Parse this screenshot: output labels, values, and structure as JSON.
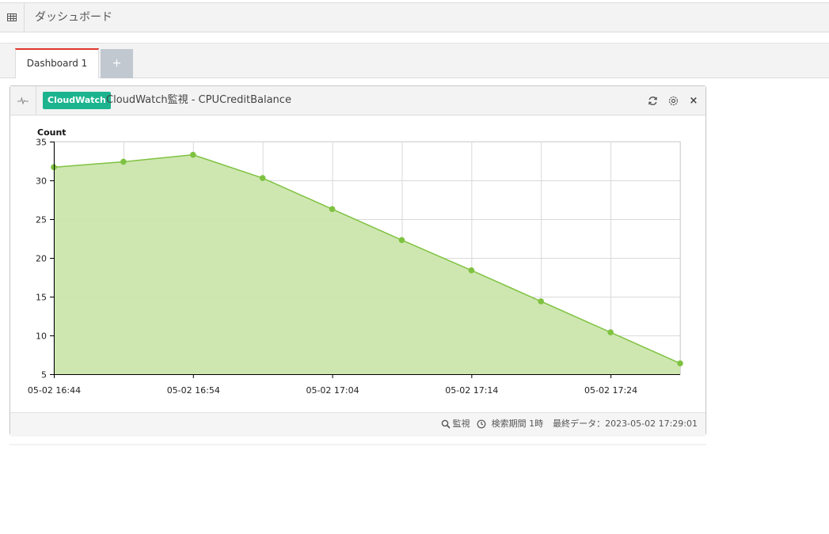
{
  "topbar": {
    "title": "ダッシュボード",
    "menu_icon": "table-grid-icon"
  },
  "tabs": [
    {
      "label": "Dashboard 1",
      "active": true
    },
    {
      "label": "+",
      "active": false
    }
  ],
  "widget": {
    "badge": "CloudWatch",
    "title": "CloudWatch監視 - CPUCreditBalance",
    "icons": [
      "pulse-icon",
      "refresh-icon",
      "settings-icon",
      "close-icon"
    ],
    "close_label": "×",
    "footer": {
      "monitor_label": "監視",
      "period_label": "検索期間 1時",
      "last_data_label": "最終データ：2023-05-02 17:29:01"
    }
  },
  "colors": {
    "accent_tab": "#e0362b",
    "badge": "#1cb48f",
    "series_line": "#7fc241",
    "series_fill": "#cbe6ac"
  },
  "chart_data": {
    "type": "area",
    "ylabel": "Count",
    "ylim": [
      5,
      35
    ],
    "yticks": [
      5,
      10,
      15,
      20,
      25,
      30,
      35
    ],
    "xlim": [
      0,
      45
    ],
    "x": [
      0,
      5,
      10,
      15,
      20,
      25,
      30,
      35,
      40,
      45
    ],
    "values": [
      31.7,
      32.4,
      33.3,
      30.3,
      26.3,
      22.3,
      18.4,
      14.4,
      10.4,
      6.4
    ],
    "xtick_positions": [
      0,
      10,
      20,
      30,
      40
    ],
    "xtick_labels": [
      "05-02 16:44",
      "05-02 16:54",
      "05-02 17:04",
      "05-02 17:14",
      "05-02 17:24"
    ],
    "grid": true
  }
}
